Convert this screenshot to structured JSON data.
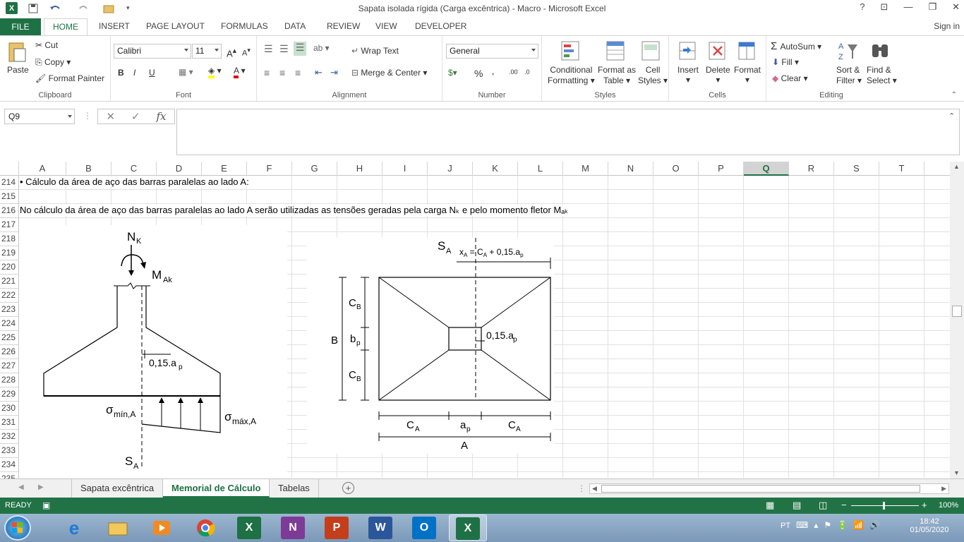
{
  "window": {
    "title": "Sapata isolada rígida (Carga excêntrica) - Macro - Microsoft Excel",
    "help": "?",
    "restore": "⊡",
    "minimize": "—",
    "maximize": "❐",
    "close": "✕"
  },
  "ribbon_tabs": {
    "file": "FILE",
    "home": "HOME",
    "insert": "INSERT",
    "page_layout": "PAGE LAYOUT",
    "formulas": "FORMULAS",
    "data": "DATA",
    "review": "REVIEW",
    "view": "VIEW",
    "developer": "DEVELOPER",
    "sign_in": "Sign in"
  },
  "clipboard": {
    "paste": "Paste",
    "cut": "Cut",
    "copy": "Copy",
    "format_painter": "Format Painter",
    "label": "Clipboard"
  },
  "font": {
    "name": "Calibri",
    "size": "11",
    "bold": "B",
    "italic": "I",
    "underline": "U",
    "label": "Font"
  },
  "alignment": {
    "wrap_text": "Wrap Text",
    "merge_center": "Merge & Center",
    "label": "Alignment"
  },
  "number": {
    "format": "General",
    "percent": "%",
    "comma": "‚",
    "label": "Number"
  },
  "styles": {
    "conditional": "Conditional",
    "formatting": "Formatting",
    "format_as": "Format as",
    "table": "Table",
    "cell": "Cell",
    "cell_styles": "Styles",
    "label": "Styles"
  },
  "cells": {
    "insert": "Insert",
    "delete": "Delete",
    "format": "Format",
    "label": "Cells"
  },
  "editing": {
    "autosum": "AutoSum",
    "fill": "Fill",
    "clear": "Clear",
    "sort": "Sort &",
    "filter": "Filter",
    "find": "Find &",
    "select": "Select",
    "label": "Editing"
  },
  "formula_bar": {
    "name_box": "Q9",
    "fx": "fx",
    "formula": ""
  },
  "columns": [
    "A",
    "B",
    "C",
    "D",
    "E",
    "F",
    "G",
    "H",
    "I",
    "J",
    "K",
    "L",
    "M",
    "N",
    "O",
    "P",
    "Q",
    "R",
    "S",
    "T"
  ],
  "rows": [
    "214",
    "215",
    "216",
    "217",
    "218",
    "219",
    "220",
    "221",
    "222",
    "223",
    "224",
    "225",
    "226",
    "227",
    "228",
    "229",
    "230",
    "231",
    "232",
    "233",
    "234",
    "235"
  ],
  "cells_text": {
    "r214": "• Cálculo da área de aço das barras paralelas ao lado A:",
    "r216": "No cálculo da área de aço das barras paralelas ao lado A serão utilizadas as tensões geradas pela carga Nₖ e pelo momento fletor Mₐₖ"
  },
  "diagram_left": {
    "nk": "N",
    "nk_sub": "K",
    "mak": "M",
    "mak_sub": "Ak",
    "dim": "0,15.a",
    "dim_sub": "p",
    "smin": "σ",
    "smin_sub": "mín,A",
    "smax": "σ",
    "smax_sub": "máx,A",
    "sa": "S",
    "sa_sub": "A"
  },
  "diagram_right": {
    "sa": "S",
    "sa_sub": "A",
    "xa": "x",
    "xa_sub": "A",
    "xa_eq": " = C",
    "xa_eq_sub": "A",
    "xa_rest": " + 0,15.a",
    "xa_rest_sub": "p",
    "cb": "C",
    "cb_sub": "B",
    "bp": "b",
    "bp_sub": "p",
    "b": "B",
    "dim": "0,15.a",
    "dim_sub": "p",
    "ca": "C",
    "ca_sub": "A",
    "ap": "a",
    "ap_sub": "p",
    "a": "A"
  },
  "sheets": {
    "tab1": "Sapata excêntrica",
    "tab2": "Memorial de Cálculo",
    "tab3": "Tabelas",
    "add": "+"
  },
  "status": {
    "ready": "READY",
    "zoom": "100%"
  },
  "taskbar": {
    "time": "18:42",
    "date": "01/05/2020",
    "lang": "PT"
  }
}
